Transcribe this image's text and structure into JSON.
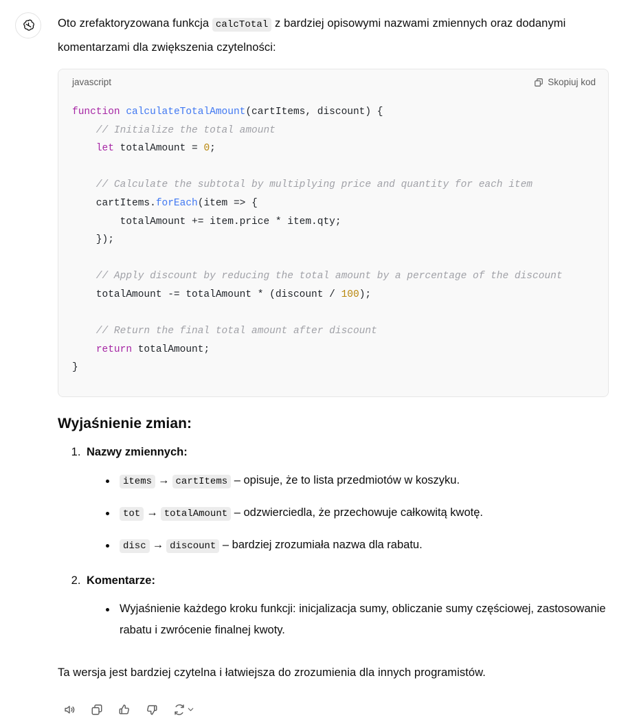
{
  "avatar": {
    "icon": "openai-logo-icon"
  },
  "intro": {
    "before_code": "Oto zrefaktoryzowana funkcja",
    "code_chip": "calcTotal",
    "after_code": "z bardziej opisowymi nazwami zmiennych oraz dodanymi komentarzami dla zwiększenia czytelności:"
  },
  "code_block": {
    "language": "javascript",
    "copy_label": "Skopiuj kod",
    "copy_icon": "copy-icon",
    "lines": [
      {
        "tokens": [
          {
            "t": "kw",
            "v": "function"
          },
          {
            "t": "pln",
            "v": " "
          },
          {
            "t": "fn",
            "v": "calculateTotalAmount"
          },
          {
            "t": "pln",
            "v": "(cartItems, discount) {"
          }
        ]
      },
      {
        "tokens": [
          {
            "t": "com",
            "v": "    // Initialize the total amount"
          }
        ]
      },
      {
        "tokens": [
          {
            "t": "pln",
            "v": "    "
          },
          {
            "t": "kw",
            "v": "let"
          },
          {
            "t": "pln",
            "v": " totalAmount = "
          },
          {
            "t": "num",
            "v": "0"
          },
          {
            "t": "pln",
            "v": ";"
          }
        ]
      },
      {
        "tokens": [
          {
            "t": "pln",
            "v": ""
          }
        ]
      },
      {
        "tokens": [
          {
            "t": "com",
            "v": "    // Calculate the subtotal by multiplying price and quantity for each item"
          }
        ]
      },
      {
        "tokens": [
          {
            "t": "pln",
            "v": "    cartItems."
          },
          {
            "t": "fn",
            "v": "forEach"
          },
          {
            "t": "pln",
            "v": "(item => {"
          }
        ]
      },
      {
        "tokens": [
          {
            "t": "pln",
            "v": "        totalAmount += item.price * item.qty;"
          }
        ]
      },
      {
        "tokens": [
          {
            "t": "pln",
            "v": "    });"
          }
        ]
      },
      {
        "tokens": [
          {
            "t": "pln",
            "v": ""
          }
        ]
      },
      {
        "tokens": [
          {
            "t": "com",
            "v": "    // Apply discount by reducing the total amount by a percentage of the discount"
          }
        ]
      },
      {
        "tokens": [
          {
            "t": "pln",
            "v": "    totalAmount -= totalAmount * (discount / "
          },
          {
            "t": "num",
            "v": "100"
          },
          {
            "t": "pln",
            "v": ");"
          }
        ]
      },
      {
        "tokens": [
          {
            "t": "pln",
            "v": ""
          }
        ]
      },
      {
        "tokens": [
          {
            "t": "com",
            "v": "    // Return the final total amount after discount"
          }
        ]
      },
      {
        "tokens": [
          {
            "t": "pln",
            "v": "    "
          },
          {
            "t": "kw",
            "v": "return"
          },
          {
            "t": "pln",
            "v": " totalAmount;"
          }
        ]
      },
      {
        "tokens": [
          {
            "t": "pln",
            "v": "}"
          }
        ]
      }
    ]
  },
  "explanation": {
    "heading": "Wyjaśnienie zmian:",
    "items": [
      {
        "title": "Nazwy zmiennych:",
        "bullets": [
          {
            "from": "items",
            "arrow": "→",
            "to": "cartItems",
            "text": "– opisuje, że to lista przedmiotów w koszyku."
          },
          {
            "from": "tot",
            "arrow": "→",
            "to": "totalAmount",
            "text": "– odzwierciedla, że przechowuje całkowitą kwotę."
          },
          {
            "from": "disc",
            "arrow": "→",
            "to": "discount",
            "text": "– bardziej zrozumiała nazwa dla rabatu."
          }
        ]
      },
      {
        "title": "Komentarze:",
        "bullets": [
          {
            "text": "Wyjaśnienie każdego kroku funkcji: inicjalizacja sumy, obliczanie sumy częściowej, zastosowanie rabatu i zwrócenie finalnej kwoty."
          }
        ]
      }
    ]
  },
  "closing": "Ta wersja jest bardziej czytelna i łatwiejsza do zrozumienia dla innych programistów.",
  "actions": [
    {
      "name": "read-aloud-button",
      "icon": "speaker-icon"
    },
    {
      "name": "copy-button",
      "icon": "copy-icon"
    },
    {
      "name": "thumbs-up-button",
      "icon": "thumbs-up-icon"
    },
    {
      "name": "thumbs-down-button",
      "icon": "thumbs-down-icon"
    },
    {
      "name": "regenerate-button",
      "icon": "refresh-icon"
    }
  ],
  "colors": {
    "code_bg": "#f9f9f9",
    "chip_bg": "#ececec",
    "keyword": "#a626a4",
    "function": "#4078f2",
    "number": "#b8860b",
    "comment": "#a0a1a7",
    "text": "#0d0d0d"
  }
}
